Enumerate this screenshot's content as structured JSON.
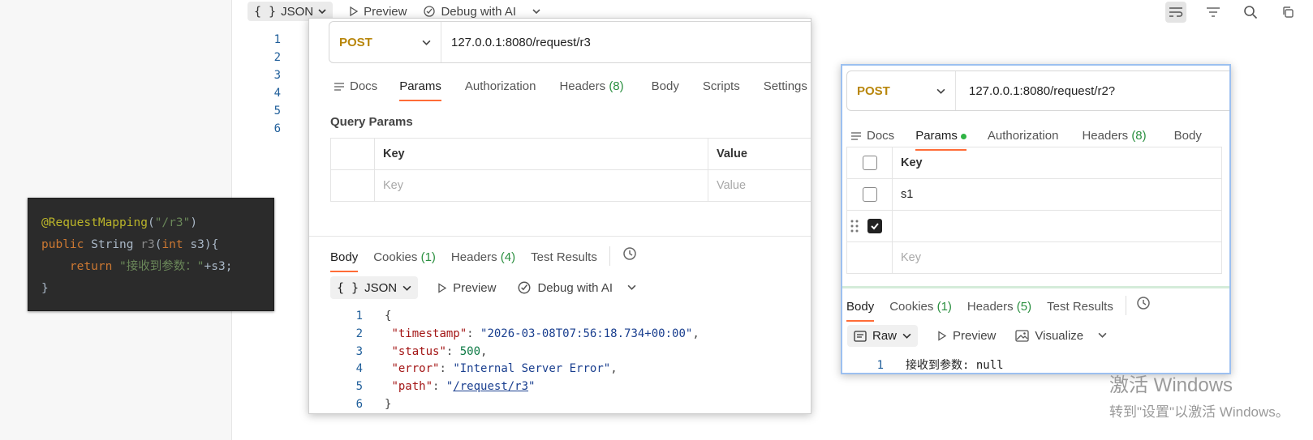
{
  "background": {
    "format_label": "JSON",
    "preview_label": "Preview",
    "debug_label": "Debug with AI",
    "line_numbers": [
      "1",
      "2",
      "3",
      "4",
      "5",
      "6"
    ]
  },
  "snippet": {
    "line1_ann": "@RequestMapping",
    "line1_str": "\"/r3\"",
    "line2_kw": "public",
    "line2_type": "String",
    "line2_method": "r3",
    "line2_param_kw": "int",
    "line2_param": "s3",
    "line3_kw": "return",
    "line3_str": "\"接收到参数：\"",
    "line3_rest": "+s3;",
    "line4": "}"
  },
  "request1": {
    "method": "POST",
    "url": "127.0.0.1:8080/request/r3",
    "tabs": {
      "docs": "Docs",
      "params": "Params",
      "authorization": "Authorization",
      "headers": "Headers",
      "headers_count": "(8)",
      "body": "Body",
      "scripts": "Scripts",
      "settings": "Settings"
    },
    "query_params_title": "Query Params",
    "table": {
      "key_header": "Key",
      "value_header": "Value",
      "key_placeholder": "Key",
      "value_placeholder": "Value"
    },
    "response_tabs": {
      "body": "Body",
      "cookies": "Cookies",
      "cookies_count": "(1)",
      "headers": "Headers",
      "headers_count": "(4)",
      "test_results": "Test Results"
    },
    "response_toolbar": {
      "format": "JSON",
      "preview": "Preview",
      "debug": "Debug with AI"
    },
    "response_json": {
      "timestamp_key": "\"timestamp\"",
      "timestamp_value": "\"2026-03-08T07:56:18.734+00:00\"",
      "status_key": "\"status\"",
      "status_value": "500",
      "error_key": "\"error\"",
      "error_value": "\"Internal Server Error\"",
      "path_key": "\"path\"",
      "path_value": "/request/r3"
    }
  },
  "request2": {
    "method": "POST",
    "url": "127.0.0.1:8080/request/r2?",
    "tabs": {
      "docs": "Docs",
      "params": "Params",
      "authorization": "Authorization",
      "headers": "Headers",
      "headers_count": "(8)",
      "body": "Body"
    },
    "table": {
      "key_header": "Key",
      "row1_key": "s1",
      "key_placeholder": "Key"
    },
    "response_tabs": {
      "body": "Body",
      "cookies": "Cookies",
      "cookies_count": "(1)",
      "headers": "Headers",
      "headers_count": "(5)",
      "test_results": "Test Results"
    },
    "response_toolbar": {
      "format": "Raw",
      "preview": "Preview",
      "visualize": "Visualize"
    },
    "response_line_number": "1",
    "response_text": "接收到参数: null"
  },
  "watermark": {
    "line1": "激活 Windows",
    "line2": "转到\"设置\"以激活 Windows。"
  }
}
